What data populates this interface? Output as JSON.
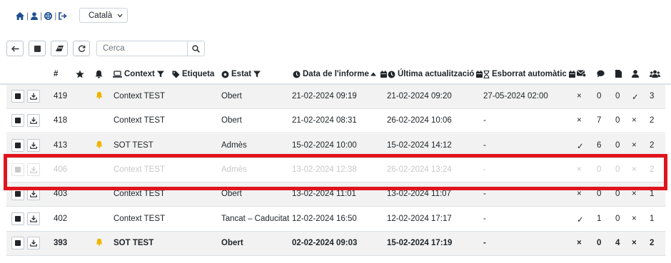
{
  "nav": {
    "separator": "|"
  },
  "language": {
    "selected": "Català"
  },
  "search": {
    "placeholder": "Cerca"
  },
  "table": {
    "headers": {
      "num": "#",
      "context": "Context",
      "tag": "Etiqueta",
      "status": "Estat",
      "report_date": "Data de l'informe",
      "last_update": "Última actualització",
      "auto_delete": "Esborrat automàtic"
    },
    "rows": [
      {
        "id": "419",
        "context": "Context TEST",
        "status": "Obert",
        "date": "21-02-2024 09:19",
        "updated": "21-02-2024 09:20",
        "expire": "27-05-2024 02:00",
        "c1": "×",
        "c2": "0",
        "c3": "0",
        "c4": "✓",
        "c5": "3"
      },
      {
        "id": "418",
        "context": "Context TEST",
        "status": "Obert",
        "date": "21-02-2024 08:31",
        "updated": "26-02-2024 10:06",
        "expire": "-",
        "c1": "×",
        "c2": "7",
        "c3": "0",
        "c4": "×",
        "c5": "2"
      },
      {
        "id": "413",
        "context": "SOT TEST",
        "status": "Admès",
        "date": "15-02-2024 10:00",
        "updated": "15-02-2024 14:12",
        "expire": "-",
        "c1": "✓",
        "c2": "6",
        "c3": "0",
        "c4": "×",
        "c5": "2"
      },
      {
        "id": "406",
        "context": "Context TEST",
        "status": "Admès",
        "date": "13-02-2024 12:38",
        "updated": "26-02-2024 13:24",
        "expire": "-",
        "c1": "×",
        "c2": "0",
        "c3": "0",
        "c4": "×",
        "c5": "2"
      },
      {
        "id": "403",
        "context": "Context TEST",
        "status": "Obert",
        "date": "13-02-2024 11:01",
        "updated": "13-02-2024 11:07",
        "expire": "-",
        "c1": "×",
        "c2": "0",
        "c3": "0",
        "c4": "×",
        "c5": "1"
      },
      {
        "id": "402",
        "context": "Context TEST",
        "status": "Tancat – Caducitat",
        "date": "12-02-2024 16:50",
        "updated": "12-02-2024 17:17",
        "expire": "-",
        "c1": "✓",
        "c2": "1",
        "c3": "0",
        "c4": "×",
        "c5": "1"
      },
      {
        "id": "393",
        "context": "SOT TEST",
        "status": "Obert",
        "date": "02-02-2024 09:03",
        "updated": "15-02-2024 17:19",
        "expire": "-",
        "c1": "×",
        "c2": "0",
        "c3": "4",
        "c4": "×",
        "c5": "2"
      }
    ]
  },
  "colors": {
    "nav_blue": "#1d4f91",
    "bell": "#f0b400",
    "highlight": "#e0141e",
    "dim_text": "#c8c8c8"
  }
}
